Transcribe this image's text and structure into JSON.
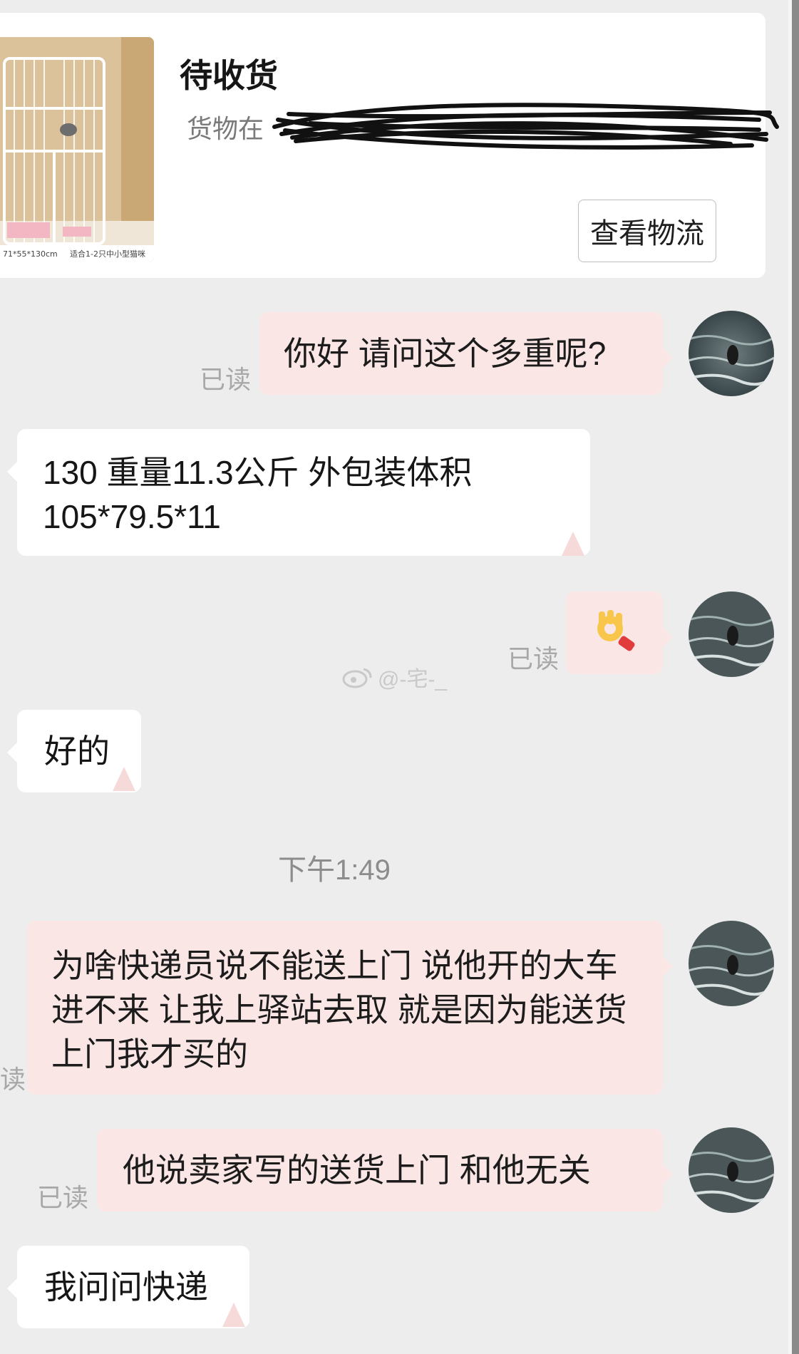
{
  "order": {
    "status": "待收货",
    "location": "货物在",
    "track_button": "查看物流",
    "image_caption_size": "71*55*130cm",
    "image_caption_note": "适合1-2只中小型猫咪"
  },
  "messages": [
    {
      "from": "me",
      "text": "你好 请问这个多重呢?",
      "read": "已读"
    },
    {
      "from": "them",
      "text": "130  重量11.3公斤   外包装体积105*79.5*11"
    },
    {
      "from": "me",
      "emoji": "ok-hand",
      "read": "已读"
    },
    {
      "from": "them",
      "text": "好的"
    },
    {
      "from": "me",
      "text": "为啥快递员说不能送上门 说他开的大车进不来 让我上驿站去取 就是因为能送货上门我才买的",
      "read": "读"
    },
    {
      "from": "me",
      "text": "他说卖家写的送货上门 和他无关",
      "read": "已读"
    },
    {
      "from": "them",
      "text": "我问问快递"
    }
  ],
  "time_separator": "下午1:49",
  "watermark": "@-宅-_",
  "colors": {
    "background": "#ededed",
    "my_bubble": "#fbe6e6",
    "their_bubble": "#ffffff",
    "read_text": "#a8a8a8"
  }
}
